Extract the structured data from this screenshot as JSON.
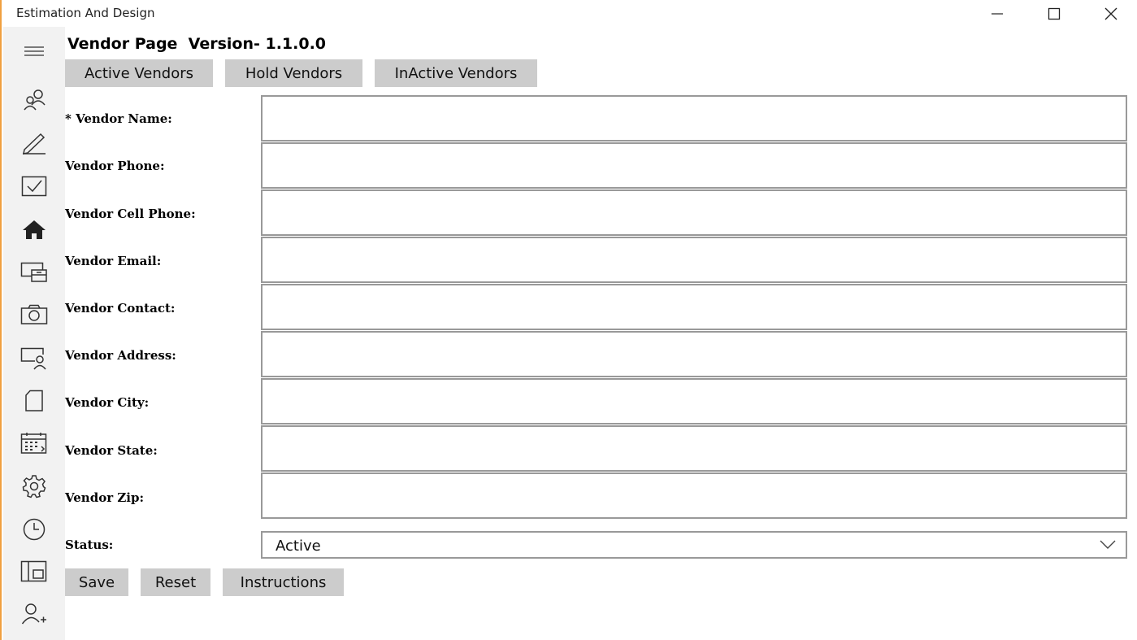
{
  "window": {
    "title": "Estimation And Design",
    "controls": [
      "minimize-icon",
      "maximize-icon",
      "close-icon"
    ]
  },
  "sidebar": {
    "items": [
      {
        "icon": "hamburger-menu-icon"
      },
      {
        "icon": "people-icon"
      },
      {
        "icon": "pencil-icon"
      },
      {
        "icon": "checkbox-icon"
      },
      {
        "icon": "home-icon"
      },
      {
        "icon": "devices-icon"
      },
      {
        "icon": "camera-icon"
      },
      {
        "icon": "screen-user-icon"
      },
      {
        "icon": "page-icon"
      },
      {
        "icon": "calendar-icon"
      },
      {
        "icon": "gear-icon"
      },
      {
        "icon": "clock-icon"
      },
      {
        "icon": "layout-icon"
      },
      {
        "icon": "add-user-icon"
      }
    ]
  },
  "page": {
    "title": "Vendor Page  Version- 1.1.0.0"
  },
  "tabs": {
    "active": "Active Vendors",
    "hold": "Hold Vendors",
    "inactive": "InActive Vendors"
  },
  "form": {
    "fields": [
      {
        "label": "* Vendor Name:",
        "value": ""
      },
      {
        "label": "Vendor Phone:",
        "value": ""
      },
      {
        "label": "Vendor Cell Phone:",
        "value": ""
      },
      {
        "label": "Vendor Email:",
        "value": ""
      },
      {
        "label": "Vendor Contact:",
        "value": ""
      },
      {
        "label": "Vendor Address:",
        "value": ""
      },
      {
        "label": "Vendor City:",
        "value": ""
      },
      {
        "label": "Vendor State:",
        "value": ""
      },
      {
        "label": "Vendor Zip:",
        "value": ""
      }
    ],
    "status_label": "Status:",
    "status_value": "Active"
  },
  "actions": {
    "save": "Save",
    "reset": "Reset",
    "instructions": "Instructions"
  },
  "colors": {
    "sidebar_bg": "#f2f2f2",
    "button_bg": "#cccccc",
    "input_border": "#999999",
    "window_accent": "#f0a040"
  }
}
